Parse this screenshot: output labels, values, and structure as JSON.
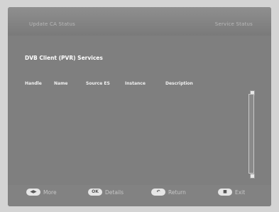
{
  "header": {
    "left_label": "Update CA Status",
    "right_label": "Service Status"
  },
  "main": {
    "section_title": "DVB Client (PVR) Services",
    "columns": [
      "Handle",
      "Name",
      "Source ES",
      "Instance",
      "Description"
    ]
  },
  "footer": {
    "actions": [
      {
        "key": "◀▶",
        "label": "More"
      },
      {
        "key": "OK",
        "label": "Details"
      },
      {
        "key": "↶",
        "label": "Return"
      },
      {
        "key": "■",
        "label": "Exit"
      }
    ]
  }
}
